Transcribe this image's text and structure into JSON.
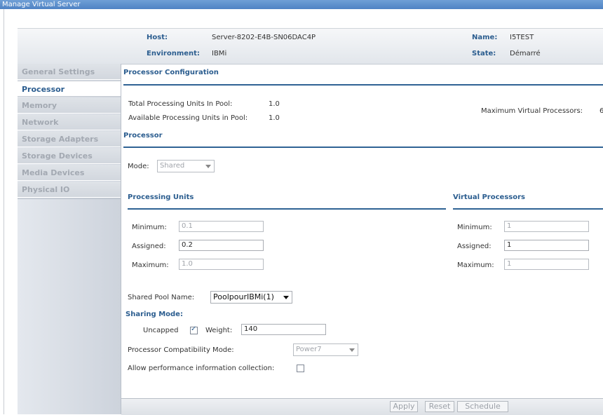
{
  "window": {
    "title": "Manage Virtual Server"
  },
  "header": {
    "host_label": "Host:",
    "host_value": "Server-8202-E4B-SN06DAC4P",
    "env_label": "Environment:",
    "env_value": "IBMi",
    "name_label": "Name:",
    "name_value": "I5TEST",
    "state_label": "State:",
    "state_value": "Démarré"
  },
  "sidebar": {
    "items": [
      {
        "label": "General Settings"
      },
      {
        "label": "Processor"
      },
      {
        "label": "Memory"
      },
      {
        "label": "Network"
      },
      {
        "label": "Storage Adapters"
      },
      {
        "label": "Storage Devices"
      },
      {
        "label": "Media Devices"
      },
      {
        "label": "Physical IO"
      }
    ]
  },
  "main": {
    "processor_config_title": "Processor Configuration",
    "total_pool_label": "Total Processing Units In Pool:",
    "total_pool_value": "1.0",
    "available_pool_label": "Available Processing Units in Pool:",
    "available_pool_value": "1.0",
    "max_vp_label": "Maximum Virtual Processors:",
    "max_vp_value": "6",
    "processor_title": "Processor",
    "mode_label": "Mode:",
    "mode_value": "Shared",
    "processing_units_title": "Processing Units",
    "virtual_processors_title": "Virtual Processors",
    "pu": {
      "min_label": "Minimum:",
      "min_value": "0.1",
      "assigned_label": "Assigned:",
      "assigned_value": "0.2",
      "max_label": "Maximum:",
      "max_value": "1.0"
    },
    "vp": {
      "min_label": "Minimum:",
      "min_value": "1",
      "assigned_label": "Assigned:",
      "assigned_value": "1",
      "max_label": "Maximum:",
      "max_value": "1"
    },
    "shared_pool_label": "Shared Pool Name:",
    "shared_pool_value": "PoolpourIBMi(1)",
    "sharing_mode_title": "Sharing Mode:",
    "uncapped_label": "Uncapped",
    "weight_label": "Weight:",
    "weight_value": "140",
    "compat_label": "Processor Compatibility Mode:",
    "compat_value": "Power7",
    "perf_label": "Allow performance information collection:"
  },
  "footer": {
    "apply": "Apply",
    "reset": "Reset",
    "schedule": "Schedule"
  }
}
